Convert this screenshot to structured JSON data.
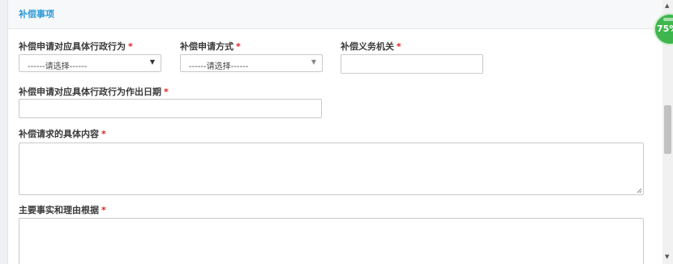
{
  "panel": {
    "title": "补偿事项"
  },
  "fields": {
    "behavior": {
      "label": "补偿申请对应具体行政行为",
      "required_mark": "*",
      "selected": "------请选择------"
    },
    "method": {
      "label": "补偿申请方式",
      "required_mark": "*",
      "selected": "------请选择------"
    },
    "authority": {
      "label": "补偿义务机关",
      "required_mark": "*",
      "value": ""
    },
    "date": {
      "label": "补偿申请对应具体行政行为作出日期",
      "required_mark": "*",
      "value": ""
    },
    "content": {
      "label": "补偿请求的具体内容",
      "required_mark": "*",
      "value": ""
    },
    "facts": {
      "label": "主要事实和理由根据",
      "required_mark": "*",
      "value": ""
    }
  },
  "badge": {
    "text": "75%"
  },
  "colors": {
    "title": "#2a9ad8",
    "required": "#e02020",
    "badge": "#3fb64d"
  },
  "icons": {
    "select_arrow": "triangle-down",
    "scroll_up": "scroll-up-arrow",
    "scroll_down": "scroll-down-arrow"
  }
}
